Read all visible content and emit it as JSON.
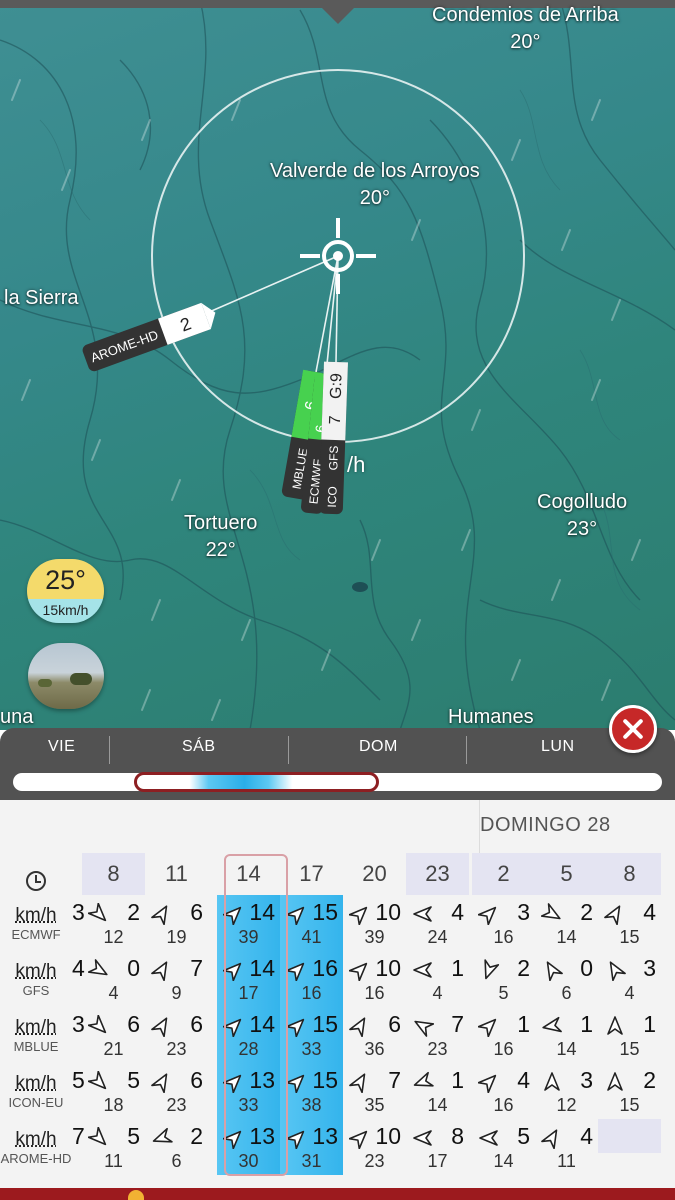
{
  "map": {
    "towns": [
      {
        "name": "Condemios de Arriba",
        "temp": "20°"
      },
      {
        "name": "Valverde de los Arroyos",
        "temp": "20°"
      },
      {
        "name": "la Sierra",
        "temp": ""
      },
      {
        "name": "Tortuero",
        "temp": "22°"
      },
      {
        "name": "Cogolludo",
        "temp": "23°"
      },
      {
        "name": "Humanes",
        "temp": ""
      },
      {
        "name": "una",
        "temp": ""
      }
    ],
    "wind_speed_fragment": "/h",
    "models": [
      {
        "name": "AROME-HD",
        "value": "2"
      },
      {
        "name": "MBLUE",
        "value": "6"
      },
      {
        "name": "ECMWF",
        "value": "6"
      },
      {
        "name": "ICO",
        "value": "7"
      },
      {
        "name": "GFS",
        "value": "G:9"
      }
    ],
    "temp_bubble": {
      "temp": "25°",
      "wind": "15km/h"
    },
    "icons": [
      "crosshair-icon",
      "webcam-thumbnail",
      "close-icon"
    ]
  },
  "timeline": {
    "days": [
      "VIE",
      "SÁB",
      "DOM",
      "LUN"
    ],
    "position_fraction": 0.37
  },
  "forecast": {
    "date_header": "DOMINGO 28",
    "hours": [
      "8",
      "11",
      "14",
      "17",
      "20",
      "23",
      "2",
      "5",
      "8"
    ],
    "selected_hour": "14",
    "rows": [
      {
        "unit": "km/h",
        "model": "ECMWF",
        "cells": [
          [
            "2",
            "12",
            135
          ],
          [
            "6",
            "19",
            30
          ],
          [
            "14",
            "39",
            45
          ],
          [
            "15",
            "41",
            45
          ],
          [
            "10",
            "39",
            45
          ],
          [
            "4",
            "24",
            270
          ],
          [
            "3",
            "16",
            45
          ],
          [
            "2",
            "14",
            120
          ],
          [
            "4",
            "15",
            30
          ]
        ]
      },
      {
        "unit": "km/h",
        "model": "GFS",
        "cells": [
          [
            "0",
            "4",
            120
          ],
          [
            "7",
            "9",
            30
          ],
          [
            "14",
            "17",
            45
          ],
          [
            "16",
            "16",
            45
          ],
          [
            "10",
            "16",
            45
          ],
          [
            "1",
            "4",
            270
          ],
          [
            "2",
            "5",
            200
          ],
          [
            "0",
            "6",
            330
          ],
          [
            "3",
            "4",
            330
          ]
        ]
      },
      {
        "unit": "km/h",
        "model": "MBLUE",
        "cells": [
          [
            "6",
            "21",
            135
          ],
          [
            "6",
            "23",
            30
          ],
          [
            "14",
            "28",
            45
          ],
          [
            "15",
            "33",
            45
          ],
          [
            "6",
            "36",
            30
          ],
          [
            "7",
            "23",
            300
          ],
          [
            "1",
            "16",
            45
          ],
          [
            "1",
            "14",
            260
          ],
          [
            "1",
            "15",
            0
          ]
        ]
      },
      {
        "unit": "km/h",
        "model": "ICON-EU",
        "cells": [
          [
            "5",
            "18",
            135
          ],
          [
            "6",
            "23",
            30
          ],
          [
            "13",
            "33",
            45
          ],
          [
            "15",
            "38",
            45
          ],
          [
            "7",
            "35",
            30
          ],
          [
            "1",
            "14",
            250
          ],
          [
            "4",
            "16",
            45
          ],
          [
            "3",
            "12",
            0
          ],
          [
            "2",
            "15",
            0
          ]
        ]
      },
      {
        "unit": "km/h",
        "model": "AROME-HD",
        "cells": [
          [
            "5",
            "11",
            135
          ],
          [
            "2",
            "6",
            250
          ],
          [
            "13",
            "30",
            45
          ],
          [
            "13",
            "31",
            45
          ],
          [
            "10",
            "23",
            45
          ],
          [
            "8",
            "17",
            270
          ],
          [
            "5",
            "14",
            270
          ],
          [
            "4",
            "11",
            30
          ],
          [
            "",
            ""
          ]
        ]
      }
    ],
    "partial_left_digits": [
      "3",
      "4",
      "3",
      "5",
      "7"
    ],
    "colors": {
      "strong_wind": "#34b4ec",
      "selected_frame": "#d9a0a6",
      "accent": "#9c1a1e"
    }
  }
}
